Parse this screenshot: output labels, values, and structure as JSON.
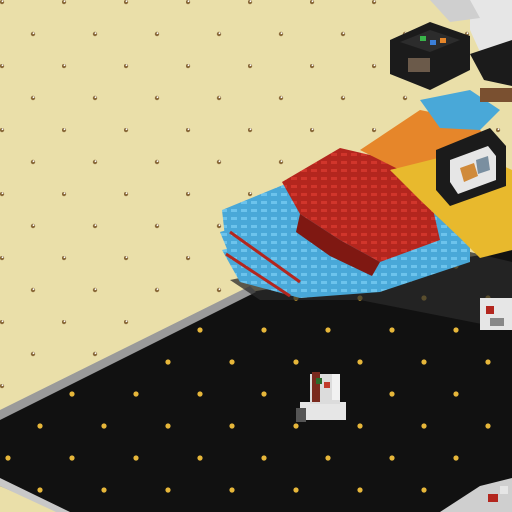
{
  "scene": {
    "colors": {
      "sand": "#eadfa9",
      "sand_speck": "#8a6a3a",
      "floor": "#111111",
      "floor_dot": "#e7b73a",
      "wall": "#9a9a9a",
      "wall_light": "#c8c8c8",
      "red_block": "#b3261e",
      "red_dark": "#7f1812",
      "blue_block": "#49a8d8",
      "blue_dark": "#2f7fb0",
      "orange_block": "#e6862a",
      "yellow_block": "#e8b92d",
      "black_block": "#1b1b1b",
      "white_block": "#e6e6e6"
    },
    "objects": [
      {
        "name": "sand-baseplate"
      },
      {
        "name": "black-floor-baseplate"
      },
      {
        "name": "grey-wall-left"
      },
      {
        "name": "grey-wall-bottom"
      },
      {
        "name": "red-blue-ramp-structure"
      },
      {
        "name": "black-control-box"
      },
      {
        "name": "screen-panel"
      },
      {
        "name": "white-robot-figure"
      },
      {
        "name": "small-white-bot"
      },
      {
        "name": "bottom-right-debris"
      }
    ]
  }
}
